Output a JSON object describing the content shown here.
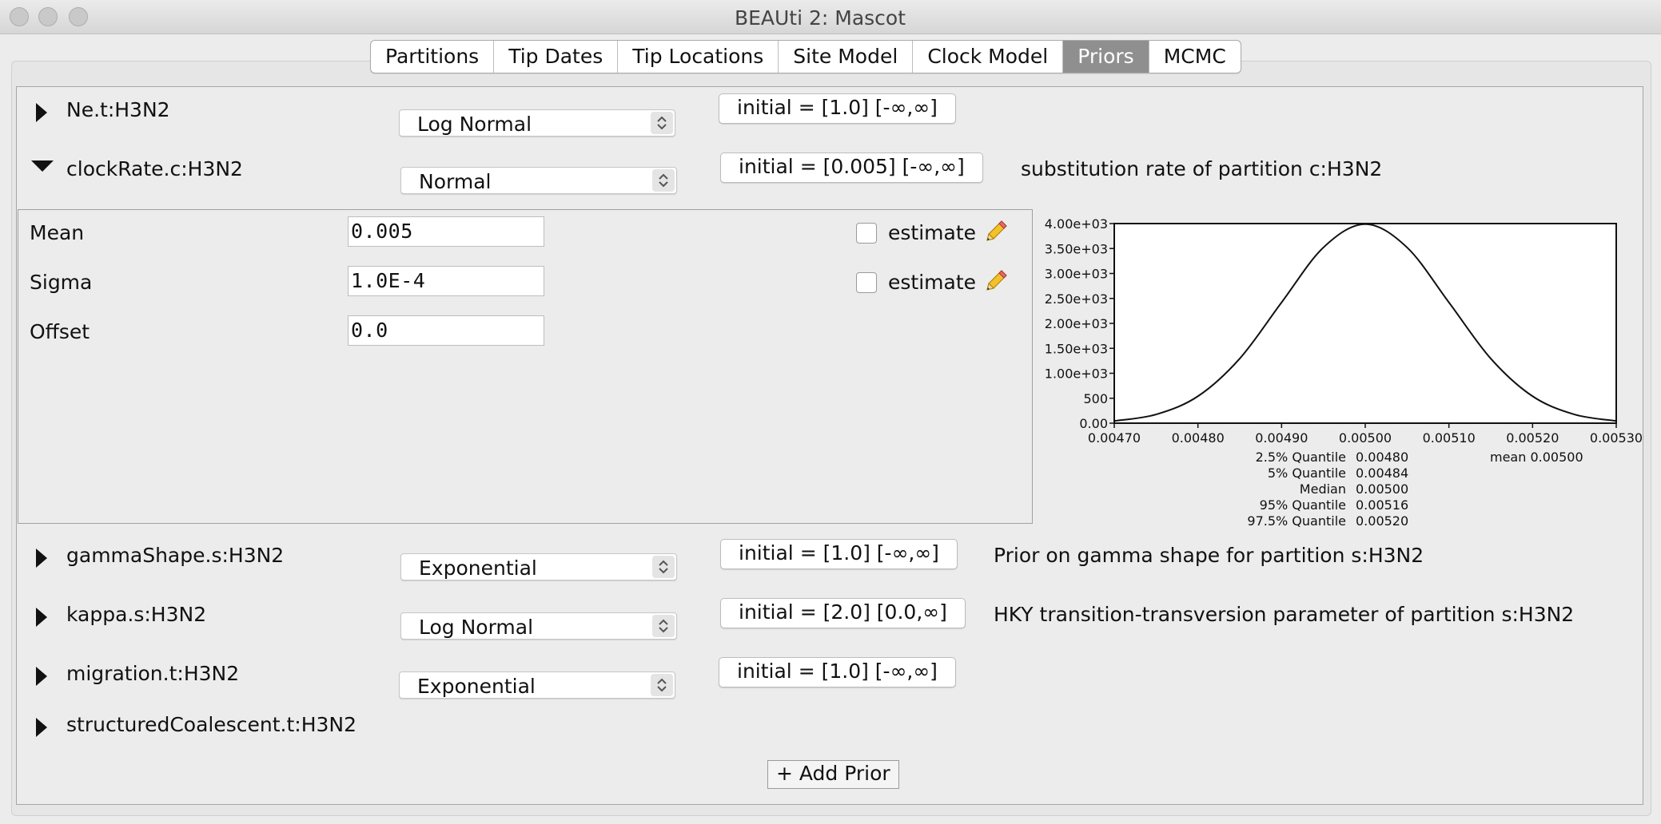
{
  "window": {
    "title": "BEAUti 2: Mascot"
  },
  "tabs": [
    {
      "label": "Partitions",
      "active": false
    },
    {
      "label": "Tip Dates",
      "active": false
    },
    {
      "label": "Tip Locations",
      "active": false
    },
    {
      "label": "Site Model",
      "active": false
    },
    {
      "label": "Clock Model",
      "active": false
    },
    {
      "label": "Priors",
      "active": true
    },
    {
      "label": "MCMC",
      "active": false
    }
  ],
  "priors": [
    {
      "name": "Ne.t:H3N2",
      "distribution": "Log Normal",
      "initial": "initial = [1.0] [-∞,∞]",
      "description": "",
      "expanded": false
    },
    {
      "name": "clockRate.c:H3N2",
      "distribution": "Normal",
      "initial": "initial = [0.005] [-∞,∞]",
      "description": "substitution rate of partition c:H3N2",
      "expanded": true
    },
    {
      "name": "gammaShape.s:H3N2",
      "distribution": "Exponential",
      "initial": "initial = [1.0] [-∞,∞]",
      "description": "Prior on gamma shape for partition s:H3N2",
      "expanded": false
    },
    {
      "name": "kappa.s:H3N2",
      "distribution": "Log Normal",
      "initial": "initial = [2.0] [0.0,∞]",
      "description": "HKY transition-transversion parameter of partition s:H3N2",
      "expanded": false
    },
    {
      "name": "migration.t:H3N2",
      "distribution": "Exponential",
      "initial": "initial = [1.0] [-∞,∞]",
      "description": "",
      "expanded": false
    },
    {
      "name": "structuredCoalescent.t:H3N2",
      "distribution": "",
      "initial": "",
      "description": "",
      "expanded": false
    }
  ],
  "clock_params": [
    {
      "label": "Mean",
      "value": "0.005",
      "estimate_label": "estimate",
      "estimate": false
    },
    {
      "label": "Sigma",
      "value": "1.0E-4",
      "estimate_label": "estimate",
      "estimate": false
    },
    {
      "label": "Offset",
      "value": "0.0"
    }
  ],
  "add_prior_label": "+ Add Prior",
  "chart_data": {
    "type": "line",
    "title": "",
    "xlabel": "",
    "ylabel": "",
    "xlim": [
      0.0047,
      0.0053
    ],
    "ylim": [
      0,
      4000
    ],
    "x_ticks": [
      "0.00470",
      "0.00480",
      "0.00490",
      "0.00500",
      "0.00510",
      "0.00520",
      "0.00530"
    ],
    "y_ticks": [
      "0.00",
      "500",
      "1.00e+03",
      "1.50e+03",
      "2.00e+03",
      "2.50e+03",
      "3.00e+03",
      "3.50e+03",
      "4.00e+03"
    ],
    "series": [
      {
        "x": [
          0.0047,
          0.00475,
          0.0048,
          0.00485,
          0.0049,
          0.00495,
          0.005,
          0.00505,
          0.0051,
          0.00515,
          0.0052,
          0.00525,
          0.0053
        ],
        "y": [
          44,
          175,
          540,
          1295,
          2420,
          3521,
          3989,
          3521,
          2420,
          1295,
          540,
          175,
          44
        ]
      }
    ],
    "grid": false,
    "stats": [
      {
        "label": "2.5% Quantile",
        "value": "0.00480"
      },
      {
        "label": "5% Quantile",
        "value": "0.00484"
      },
      {
        "label": "Median",
        "value": "0.00500"
      },
      {
        "label": "95% Quantile",
        "value": "0.00516"
      },
      {
        "label": "97.5% Quantile",
        "value": "0.00520"
      }
    ],
    "mean_label": "mean 0.00500"
  }
}
